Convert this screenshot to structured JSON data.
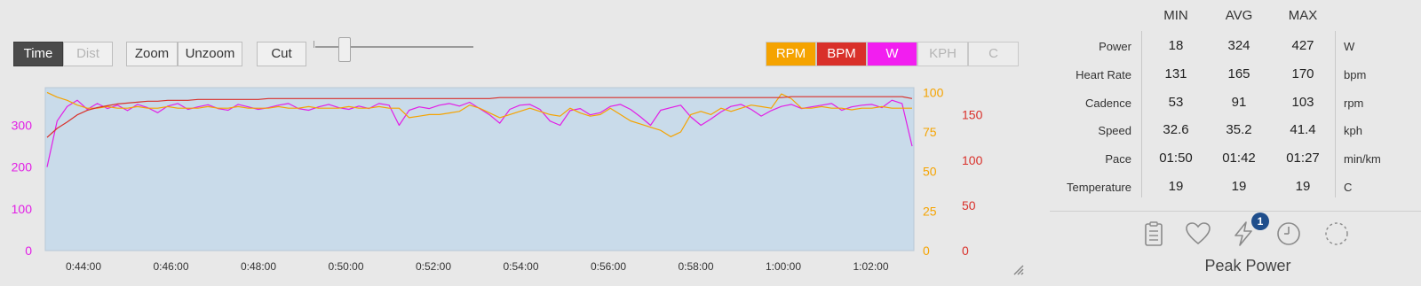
{
  "toolbar": {
    "time_label": "Time",
    "dist_label": "Dist",
    "zoom_label": "Zoom",
    "unzoom_label": "Unzoom",
    "cut_label": "Cut"
  },
  "series_toggles": [
    {
      "label": "RPM",
      "color": "#f5a300",
      "active": true
    },
    {
      "label": "BPM",
      "color": "#d9302a",
      "active": true
    },
    {
      "label": "W",
      "color": "#f21ef0",
      "active": true
    },
    {
      "label": "KPH",
      "color": "#ececec",
      "active": false
    },
    {
      "label": "C",
      "color": "#ececec",
      "active": false
    }
  ],
  "chart_data": {
    "type": "line",
    "x_ticks": [
      "0:44:00",
      "0:46:00",
      "0:48:00",
      "0:50:00",
      "0:52:00",
      "0:54:00",
      "0:56:00",
      "0:58:00",
      "1:00:00",
      "1:02:00"
    ],
    "axes": {
      "power": {
        "ticks": [
          "0",
          "100",
          "200",
          "300"
        ],
        "color": "#e21ee6",
        "range": [
          0,
          390
        ]
      },
      "cadence": {
        "ticks": [
          "0",
          "25",
          "50",
          "75",
          "100"
        ],
        "color": "#f5a300",
        "range": [
          0,
          103
        ]
      },
      "heart_rate": {
        "ticks": [
          "0",
          "50",
          "100",
          "150"
        ],
        "color": "#d9302a",
        "range": [
          0,
          180
        ]
      }
    },
    "series": [
      {
        "name": "W",
        "color": "#e21ee6",
        "axis": "power",
        "values": [
          200,
          310,
          345,
          360,
          338,
          352,
          340,
          348,
          335,
          350,
          342,
          330,
          346,
          352,
          338,
          344,
          349,
          340,
          336,
          350,
          344,
          338,
          342,
          348,
          352,
          340,
          336,
          344,
          350,
          342,
          338,
          346,
          340,
          352,
          348,
          300,
          336,
          344,
          340,
          348,
          352,
          346,
          355,
          340,
          325,
          305,
          338,
          348,
          350,
          338,
          310,
          300,
          335,
          340,
          325,
          330,
          345,
          350,
          338,
          320,
          300,
          336,
          342,
          348,
          320,
          300,
          315,
          332,
          345,
          350,
          338,
          322,
          335,
          345,
          350,
          340,
          344,
          348,
          352,
          336,
          344,
          348,
          350,
          342,
          360,
          352,
          250
        ]
      },
      {
        "name": "RPM",
        "color": "#f5a300",
        "axis": "cadence",
        "values": [
          100,
          97,
          95,
          92,
          90,
          90,
          91,
          90,
          90,
          91,
          90,
          90,
          91,
          90,
          90,
          90,
          91,
          90,
          90,
          91,
          90,
          90,
          90,
          91,
          90,
          90,
          91,
          90,
          90,
          90,
          91,
          90,
          90,
          91,
          90,
          90,
          84,
          85,
          86,
          86,
          87,
          88,
          92,
          90,
          87,
          84,
          86,
          88,
          90,
          88,
          86,
          85,
          90,
          87,
          85,
          86,
          90,
          86,
          82,
          80,
          78,
          76,
          72,
          75,
          86,
          88,
          86,
          90,
          88,
          90,
          92,
          91,
          90,
          99,
          96,
          90,
          90,
          91,
          90,
          90,
          89,
          90,
          90,
          91,
          90,
          90,
          90
        ]
      },
      {
        "name": "BPM",
        "color": "#d9302a",
        "axis": "heart_rate",
        "values": [
          125,
          135,
          142,
          150,
          155,
          158,
          160,
          162,
          163,
          164,
          165,
          165,
          166,
          166,
          166,
          167,
          167,
          167,
          167,
          167,
          167,
          167,
          168,
          168,
          168,
          168,
          168,
          168,
          168,
          168,
          168,
          168,
          168,
          168,
          168,
          168,
          168,
          168,
          168,
          168,
          168,
          168,
          168,
          168,
          168,
          169,
          169,
          169,
          169,
          169,
          169,
          169,
          169,
          169,
          169,
          169,
          169,
          169,
          169,
          169,
          169,
          169,
          169,
          169,
          169,
          169,
          169,
          169,
          169,
          169,
          169,
          169,
          169,
          169,
          170,
          170,
          170,
          170,
          170,
          170,
          170,
          170,
          170,
          170,
          170,
          170,
          168
        ]
      }
    ]
  },
  "stats": {
    "headers": [
      "MIN",
      "AVG",
      "MAX"
    ],
    "rows": [
      {
        "label": "Power",
        "min": "18",
        "avg": "324",
        "max": "427",
        "unit": "W"
      },
      {
        "label": "Heart Rate",
        "min": "131",
        "avg": "165",
        "max": "170",
        "unit": "bpm"
      },
      {
        "label": "Cadence",
        "min": "53",
        "avg": "91",
        "max": "103",
        "unit": "rpm"
      },
      {
        "label": "Speed",
        "min": "32.6",
        "avg": "35.2",
        "max": "41.4",
        "unit": "kph"
      },
      {
        "label": "Pace",
        "min": "01:50",
        "avg": "01:42",
        "max": "01:27",
        "unit": "min/km"
      },
      {
        "label": "Temperature",
        "min": "19",
        "avg": "19",
        "max": "19",
        "unit": "C"
      }
    ]
  },
  "bottom_nav": {
    "icons": [
      "clipboard-icon",
      "heart-icon",
      "lightning-icon",
      "clock-icon",
      "dashed-circle-icon"
    ],
    "badge_count": "1",
    "active_label": "Peak Power"
  }
}
